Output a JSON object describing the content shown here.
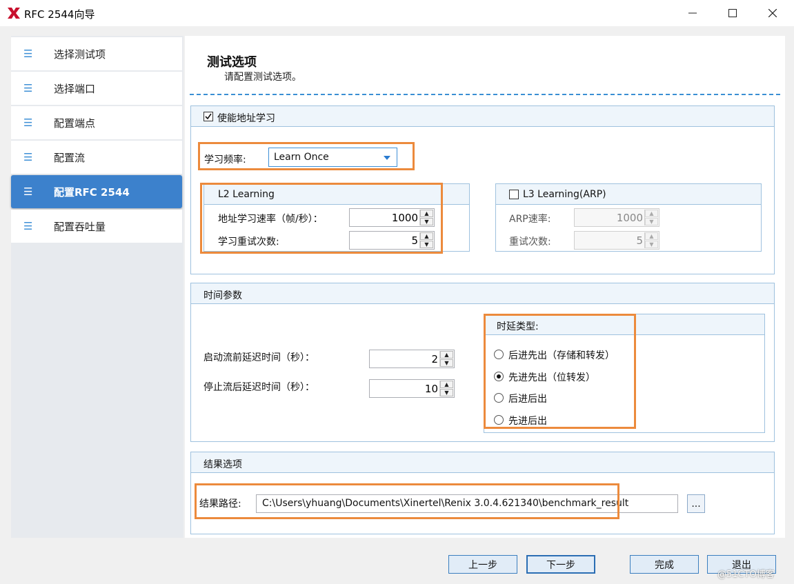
{
  "window": {
    "title": "RFC 2544向导"
  },
  "sidebar": {
    "items": [
      {
        "label": "选择测试项"
      },
      {
        "label": "选择端口"
      },
      {
        "label": "配置端点"
      },
      {
        "label": "配置流"
      },
      {
        "label": "配置RFC 2544",
        "active": true
      },
      {
        "label": "配置吞吐量"
      }
    ]
  },
  "page": {
    "title": "测试选项",
    "subtitle": "请配置测试选项。"
  },
  "address_learning": {
    "enable_label": "使能地址学习",
    "enabled": true,
    "frequency_label": "学习频率:",
    "frequency_value": "Learn Once",
    "l2": {
      "title": "L2 Learning",
      "rate_label": "地址学习速率（帧/秒）：",
      "rate_value": "1000",
      "retry_label": "学习重试次数:",
      "retry_value": "5"
    },
    "l3": {
      "title": "L3 Learning(ARP)",
      "enabled": false,
      "rate_label": "ARP速率:",
      "rate_value": "1000",
      "retry_label": "重试次数:",
      "retry_value": "5"
    }
  },
  "time_params": {
    "title": "时间参数",
    "start_delay_label": "启动流前延迟时间（秒）：",
    "start_delay_value": "2",
    "stop_delay_label": "停止流后延迟时间（秒）：",
    "stop_delay_value": "10",
    "latency": {
      "title": "时延类型:",
      "options": [
        "后进先出（存储和转发）",
        "先进先出（位转发）",
        "后进后出",
        "先进后出"
      ],
      "selected": 1
    }
  },
  "results": {
    "title": "结果选项",
    "path_label": "结果路径:",
    "path_value": "C:\\Users\\yhuang\\Documents\\Xinertel\\Renix 3.0.4.621340\\benchmark_result",
    "browse_label": "..."
  },
  "footer": {
    "prev": "上一步",
    "next": "下一步",
    "finish": "完成",
    "exit": "退出"
  },
  "watermark": "@51CTO博客",
  "colors": {
    "accent": "#3c81cc",
    "highlight_box": "#ec8a3c",
    "group_border": "#9ec1de",
    "dashed_rule": "#3a8fd4"
  }
}
